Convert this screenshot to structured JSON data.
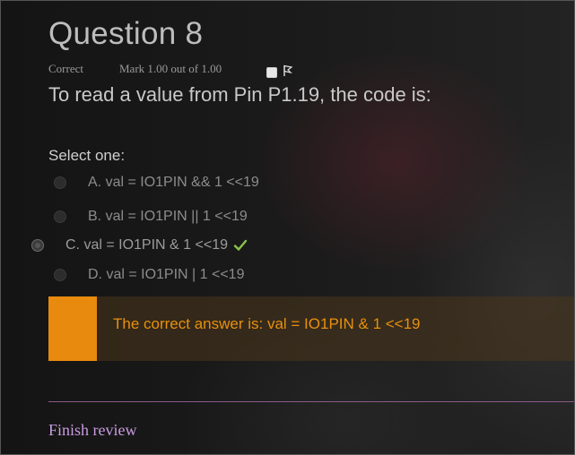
{
  "question": {
    "title": "Question 8",
    "status": "Correct",
    "mark": "Mark 1.00 out of 1.00",
    "text": "To read a value from Pin P1.19, the code is:",
    "prompt": "Select one:",
    "flag_icon": "flag-icon"
  },
  "options": [
    {
      "label": "A. val = IO1PIN && 1 <<19",
      "selected": false
    },
    {
      "label": "B. val = IO1PIN || 1 <<19",
      "selected": false
    },
    {
      "label": "C. val = IO1PIN & 1 <<19",
      "selected": true,
      "correct": true
    },
    {
      "label": "D. val = IO1PIN | 1 <<19",
      "selected": false
    }
  ],
  "feedback": {
    "text": "The correct answer is: val = IO1PIN & 1 <<19",
    "accent_color": "#e88a0e"
  },
  "footer": {
    "finish_label": "Finish review",
    "link_color": "#c99be0"
  }
}
